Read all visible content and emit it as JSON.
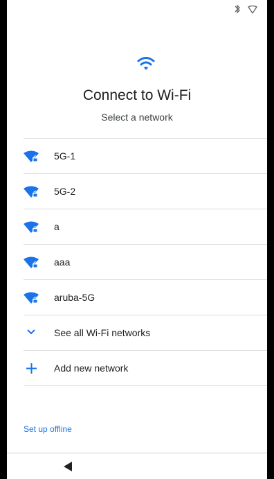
{
  "status_bar": {
    "icons": [
      "bluetooth-icon",
      "wifi-outline-icon"
    ]
  },
  "header": {
    "icon": "wifi-icon",
    "title": "Connect to Wi-Fi",
    "subtitle": "Select a network"
  },
  "networks": [
    {
      "ssid": "5G-1",
      "icon": "wifi-locked-icon"
    },
    {
      "ssid": "5G-2",
      "icon": "wifi-locked-icon"
    },
    {
      "ssid": "a",
      "icon": "wifi-locked-icon"
    },
    {
      "ssid": "aaa",
      "icon": "wifi-locked-icon"
    },
    {
      "ssid": "aruba-5G",
      "icon": "wifi-locked-icon"
    }
  ],
  "actions": {
    "see_all": {
      "label": "See all Wi-Fi networks",
      "icon": "chevron-down-icon"
    },
    "add_network": {
      "label": "Add new network",
      "icon": "plus-icon"
    }
  },
  "footer": {
    "offline_link": "Set up offline"
  },
  "nav_bar": {
    "icon": "back-triangle-icon"
  },
  "colors": {
    "accent": "#1a73e8",
    "text_primary": "#202124",
    "divider": "#dadce0"
  }
}
